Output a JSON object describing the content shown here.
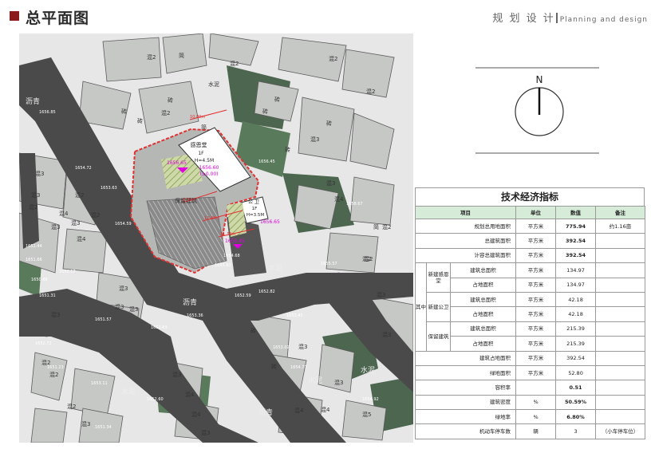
{
  "header": {
    "title": "总平面图",
    "right_cn": "规 划 设 计",
    "right_en": "Planning and design"
  },
  "map": {
    "building_main": {
      "name": "感恩堂",
      "floors": "1F",
      "height": "H=4.5M"
    },
    "elev_main": "1656.60",
    "elev_main_zero": "(±0.00)",
    "elev_court": "1656.65",
    "building_toilet": {
      "name": "公 卫",
      "floors": "1F",
      "height": "H=3.5M"
    },
    "elev_toilet": "1656.65",
    "elev_south": "1655.45",
    "preserve_label": "保留建筑",
    "road_labels": [
      "沥青",
      "沥青",
      "水泥",
      "水泥",
      "沥青",
      "水泥",
      "水泥"
    ],
    "dims": [
      "10.80m",
      "8.30m",
      "12.80m",
      "11.30m"
    ],
    "structure_labels": [
      "混2",
      "砖",
      "混2",
      "混2",
      "水泥",
      "混3",
      "砖",
      "混2",
      "砖",
      "混3",
      "混2",
      "混2",
      "混3",
      "混2",
      "混3",
      "混3",
      "混4",
      "混2",
      "混4",
      "混3",
      "混3",
      "混3",
      "混2",
      "混2",
      "混4",
      "混3",
      "混4",
      "混2",
      "混3",
      "混4",
      "混5",
      "混3",
      "砖",
      "砖",
      "混3",
      "混2",
      "混2",
      "混3",
      "混3",
      "砖",
      "简",
      "简",
      "简",
      "砖",
      "砖",
      "混2",
      "砖",
      "混4",
      "混3",
      "混3",
      "混4",
      "混3"
    ],
    "spot_elevations": [
      "1656.85",
      "1654.72",
      "1653.63",
      "1654.59",
      "1651.44",
      "1651.66",
      "1652.17",
      "1651.31",
      "1652.63",
      "1650.86",
      "1653.36",
      "1651.57",
      "1652.72",
      "1653.11",
      "1651.23",
      "1652.60",
      "1654.68",
      "1652.59",
      "1651.34",
      "1655.63",
      "1656.45",
      "1658.67",
      "1654.77",
      "1654.92",
      "1655.57",
      "1652.82",
      "1653.45",
      "1653.02"
    ]
  },
  "compass": {
    "north": "N"
  },
  "table": {
    "title": "技术经济指标",
    "headers": {
      "item": "项目",
      "unit": "单位",
      "value": "数值",
      "note": "备注"
    },
    "rows": {
      "site_area": {
        "label": "规划总用地面积",
        "unit": "平方米",
        "value": "775.94",
        "note": "约1.16亩"
      },
      "total_floor": {
        "label": "总建筑面积",
        "unit": "平方米",
        "value": "392.54"
      },
      "far_floor": {
        "label": "计容总建筑面积",
        "unit": "平方米",
        "value": "392.54"
      },
      "in_which": "其中",
      "new_hall": {
        "group": "新建感恩堂",
        "gfa_label": "建筑总面积",
        "gfa": "134.97",
        "foot_label": "占地面积",
        "foot": "134.97",
        "unit": "平方米"
      },
      "new_toilet": {
        "group": "新建公卫",
        "gfa_label": "建筑总面积",
        "gfa": "42.18",
        "foot_label": "占地面积",
        "foot": "42.18",
        "unit": "平方米"
      },
      "kept": {
        "group": "保留建筑",
        "gfa_label": "建筑总面积",
        "gfa": "215.39",
        "foot_label": "占地面积",
        "foot": "215.39",
        "unit": "平方米"
      },
      "footprint": {
        "label": "建筑占地面积",
        "unit": "平方米",
        "value": "392.54"
      },
      "green_area": {
        "label": "绿地面积",
        "unit": "平方米",
        "value": "52.80"
      },
      "far": {
        "label": "容积率",
        "value": "0.51"
      },
      "density": {
        "label": "建筑密度",
        "unit": "%",
        "value": "50.59%"
      },
      "green_ratio": {
        "label": "绿地率",
        "unit": "%",
        "value": "6.80%"
      },
      "parking": {
        "label": "机动车停车数",
        "unit": "辆",
        "value": "3",
        "note": "（小车停车位）"
      }
    }
  },
  "colors": {
    "accent": "#8b1c1c",
    "site_red": "#e03030",
    "elev_magenta": "#e000e0",
    "road": "#4a4a4a",
    "building": "#c6c8c6",
    "green": "#4d6650",
    "table_head": "#d6ecd9"
  }
}
